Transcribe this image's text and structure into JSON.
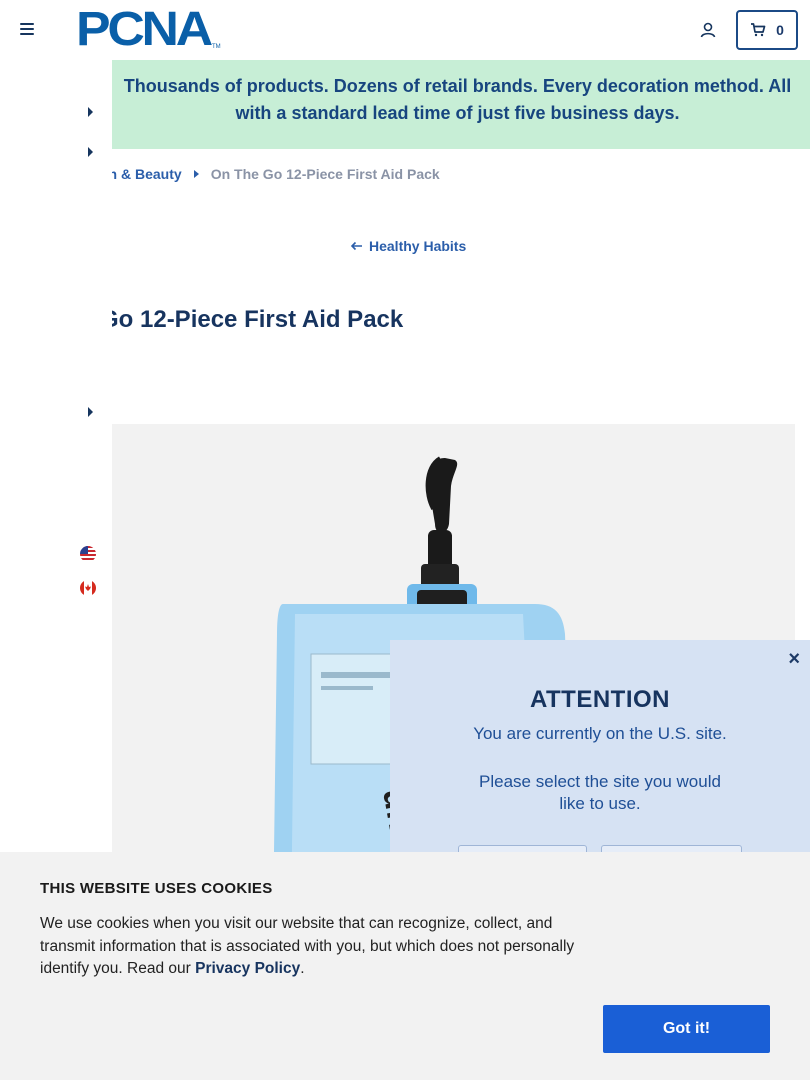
{
  "header": {
    "logo_text": "PCNA",
    "logo_tm": "TM",
    "cart_count": "0",
    "icons": {
      "menu": "hamburger-icon",
      "account": "user-icon",
      "cart": "cart-icon"
    }
  },
  "banner": {
    "text": "Thousands of products. Dozens of retail brands. Every decoration method. All with a standard lead time of just five business days."
  },
  "breadcrumb": {
    "parent": "lth & Beauty",
    "current": "On The Go 12-Piece First Aid Pack"
  },
  "back_link": {
    "label": "Healthy Habits",
    "icon": "arrow-left-icon"
  },
  "product": {
    "title": "Go 12-Piece First Aid Pack"
  },
  "site_modal": {
    "title": "ATTENTION",
    "line1": "You are currently on the U.S. site.",
    "line2": "Please select the site you would like to use.",
    "close_label": "×"
  },
  "cookie_banner": {
    "title": "THIS WEBSITE USES COOKIES",
    "text": "We use cookies when you visit our website that can recognize, collect, and transmit information that is associated with you, but which does not personally identify you. Read our",
    "link_label": "Privacy Policy",
    "trailing": ".",
    "button_label": "Got it!"
  },
  "colors": {
    "brand_blue": "#0a5fa8",
    "banner_bg": "#c7eed6",
    "modal_bg": "#d6e2f3",
    "cookie_button": "#1a5fd6"
  }
}
